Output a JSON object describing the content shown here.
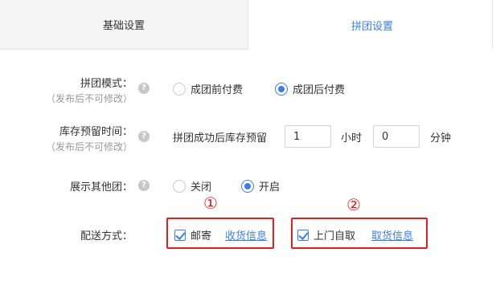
{
  "tabs": [
    {
      "label": "基础设置"
    },
    {
      "label": "拼团设置"
    }
  ],
  "group_mode": {
    "label": "拼团模式：",
    "note": "（发布后不可修改）",
    "options": [
      {
        "label": "成团前付费",
        "selected": false
      },
      {
        "label": "成团后付费",
        "selected": true
      }
    ]
  },
  "stock_hold": {
    "label": "库存预留时间：",
    "note": "（发布后不可修改）",
    "prefix": "拼团成功后库存预留",
    "hours_value": "1",
    "hours_unit": "小时",
    "minutes_value": "0",
    "minutes_unit": "分钟"
  },
  "show_other_groups": {
    "label": "展示其他团：",
    "options": [
      {
        "label": "关闭",
        "selected": false
      },
      {
        "label": "开启",
        "selected": true
      }
    ]
  },
  "delivery": {
    "label": "配送方式：",
    "options": [
      {
        "label": "邮寄",
        "checked": true,
        "link": "收货信息",
        "marker": "①"
      },
      {
        "label": "上门自取",
        "checked": true,
        "link": "取货信息",
        "marker": "②"
      }
    ]
  },
  "colors": {
    "accent": "#3b7ee8",
    "highlight": "#e02020"
  },
  "icons": {
    "help": "question-circle-icon"
  }
}
